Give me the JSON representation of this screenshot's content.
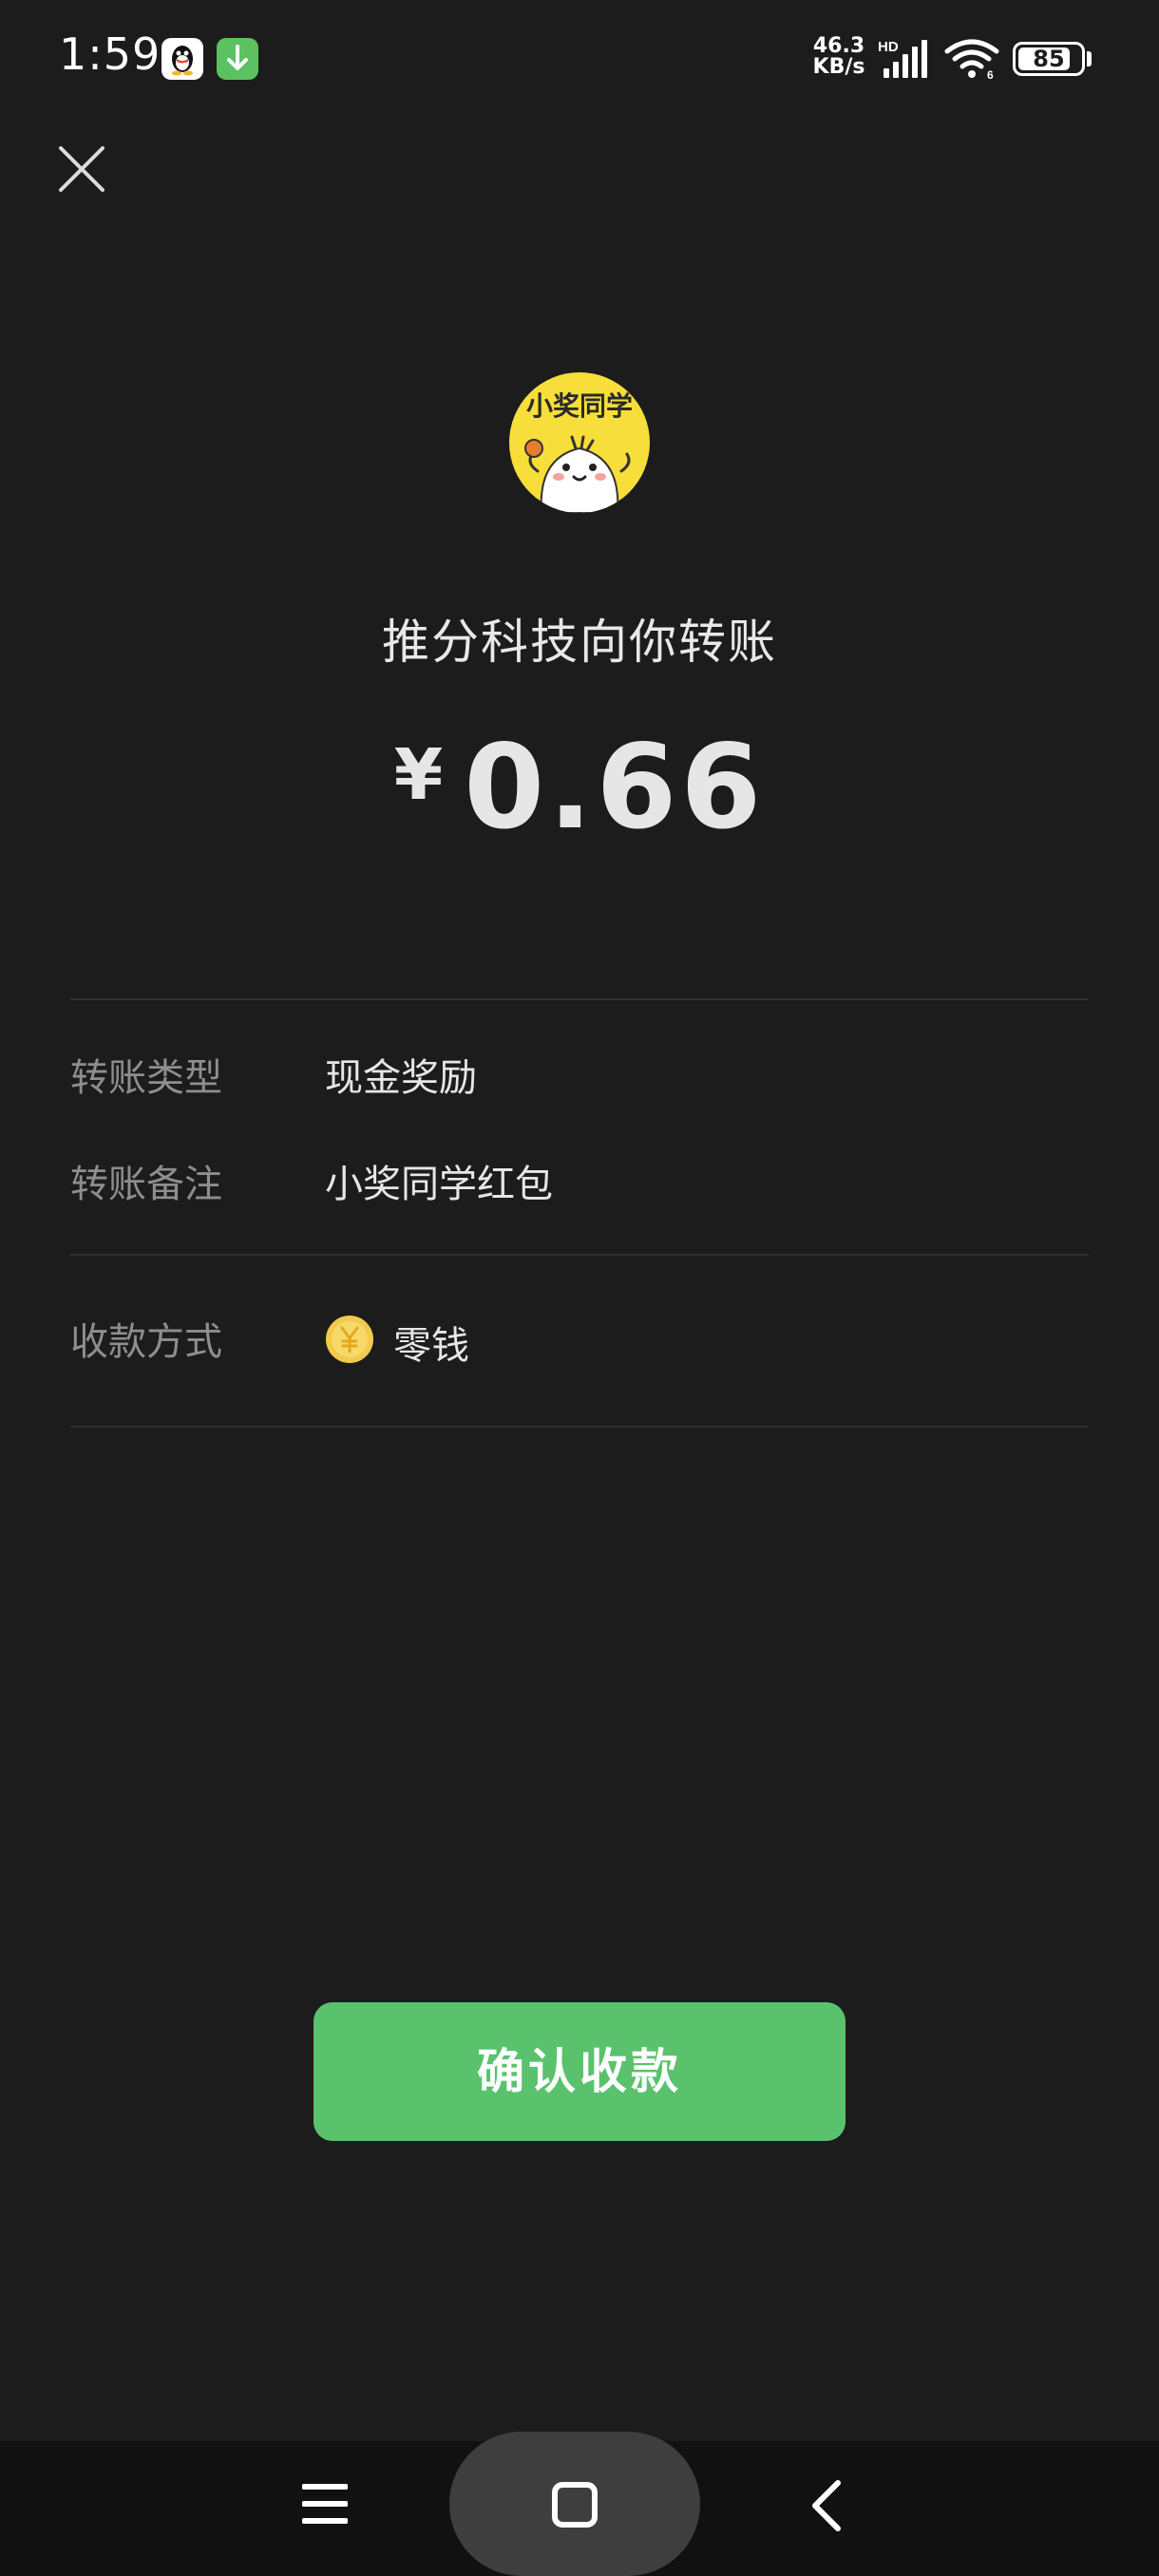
{
  "status_bar": {
    "time": "1:59",
    "net_speed_value": "46.3",
    "net_speed_unit": "KB/s",
    "signal_tag": "HD",
    "battery": "85",
    "battery_level": 0.85,
    "icons": [
      "qq-icon",
      "download-icon",
      "signal-icon",
      "wifi-icon",
      "battery-icon"
    ]
  },
  "header": {
    "close_icon": "close-icon"
  },
  "payer": {
    "avatar_text": "小奖同学",
    "line": "推分科技向你转账"
  },
  "amount": {
    "symbol": "¥",
    "value": "0.66"
  },
  "details": [
    {
      "label": "转账类型",
      "value": "现金奖励"
    },
    {
      "label": "转账备注",
      "value": "小奖同学红包"
    }
  ],
  "payment_method": {
    "label": "收款方式",
    "value": "零钱",
    "icon": "coin-icon"
  },
  "actions": {
    "confirm_label": "确认收款"
  },
  "nav": {
    "items": [
      "menu-icon",
      "home-icon",
      "back-icon"
    ]
  },
  "colors": {
    "background": "#1c1c1c",
    "accent": "#5ac26d",
    "label": "#8e8e8e",
    "avatar": "#f8de3a"
  }
}
